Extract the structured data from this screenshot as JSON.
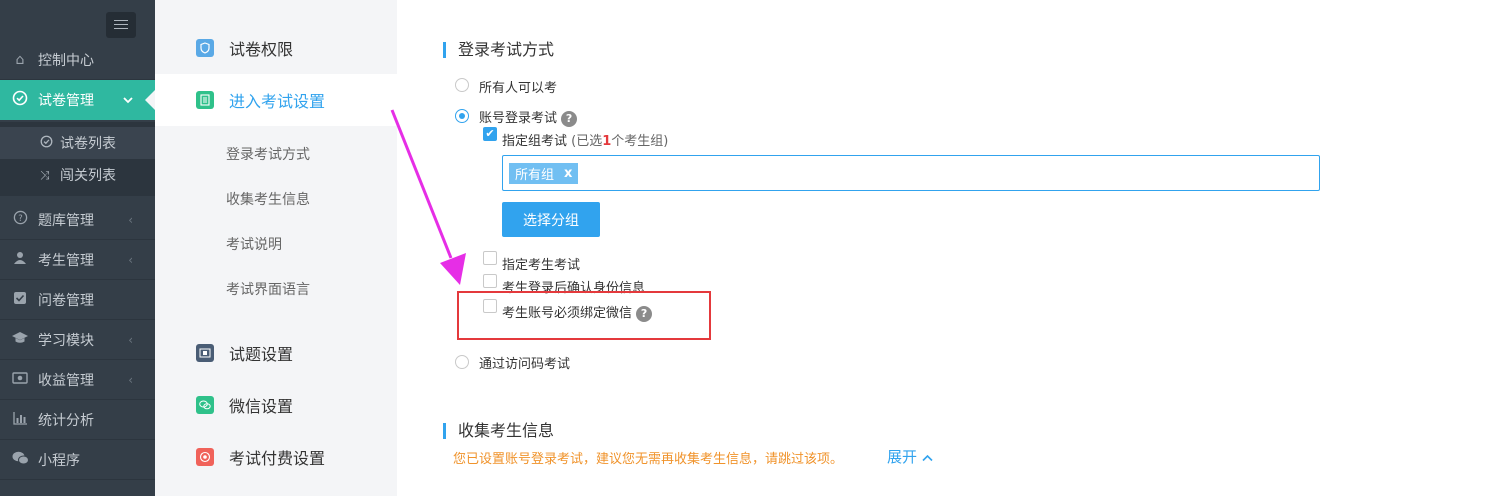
{
  "sidebar": {
    "items": [
      {
        "label": "控制中心",
        "icon": "home-icon"
      },
      {
        "label": "试卷管理",
        "icon": "check-circle-icon",
        "active": true
      },
      {
        "label": "题库管理",
        "icon": "question-circle-icon"
      },
      {
        "label": "考生管理",
        "icon": "user-icon"
      },
      {
        "label": "问卷管理",
        "icon": "checkbox-icon"
      },
      {
        "label": "学习模块",
        "icon": "graduation-cap-icon"
      },
      {
        "label": "收益管理",
        "icon": "money-icon"
      },
      {
        "label": "统计分析",
        "icon": "bar-chart-icon"
      },
      {
        "label": "小程序",
        "icon": "wechat-icon"
      }
    ],
    "sub_items": [
      {
        "label": "试卷列表",
        "icon": "check-circle-icon"
      },
      {
        "label": "闯关列表",
        "icon": "shuffle-icon"
      }
    ]
  },
  "settings_nav": {
    "main": [
      {
        "label": "试卷权限",
        "icon": "shield-icon",
        "color": "#5aa9e6"
      },
      {
        "label": "进入考试设置",
        "icon": "document-icon",
        "color": "#2fc18a"
      },
      {
        "label": "试题设置",
        "icon": "film-icon",
        "color": "#4a5d75"
      },
      {
        "label": "微信设置",
        "icon": "wechat-icon",
        "color": "#2fc18a"
      },
      {
        "label": "考试付费设置",
        "icon": "coin-icon",
        "color": "#f0625a"
      }
    ],
    "sub": [
      "登录考试方式",
      "收集考生信息",
      "考试说明",
      "考试界面语言"
    ]
  },
  "login_section": {
    "title": "登录考试方式",
    "options": {
      "anyone": "所有人可以考",
      "account": "账号登录考试",
      "access_code": "通过访问码考试"
    },
    "group_exam": {
      "label": "指定组考试",
      "hint_prefix": "(已选",
      "hint_count": "1",
      "hint_suffix": "个考生组)"
    },
    "tag": "所有组",
    "tag_close": "x",
    "select_button": "选择分组",
    "checkboxes": {
      "specific_examinee": "指定考生考试",
      "confirm_identity": "考生登录后确认身份信息",
      "bind_wechat": "考生账号必须绑定微信"
    },
    "help_glyph": "?"
  },
  "collect_section": {
    "title": "收集考生信息",
    "notice": "您已设置账号登录考试，建议您无需再收集考生信息，请跳过该项。",
    "expand_label": "展开"
  },
  "colors": {
    "sidebar_bg": "#343e48",
    "sidebar_active": "#2fb8a0",
    "accent": "#31a3ee",
    "annotation_arrow": "#e62ee6",
    "highlight_box": "#e4393c",
    "notice": "#f0932b"
  }
}
